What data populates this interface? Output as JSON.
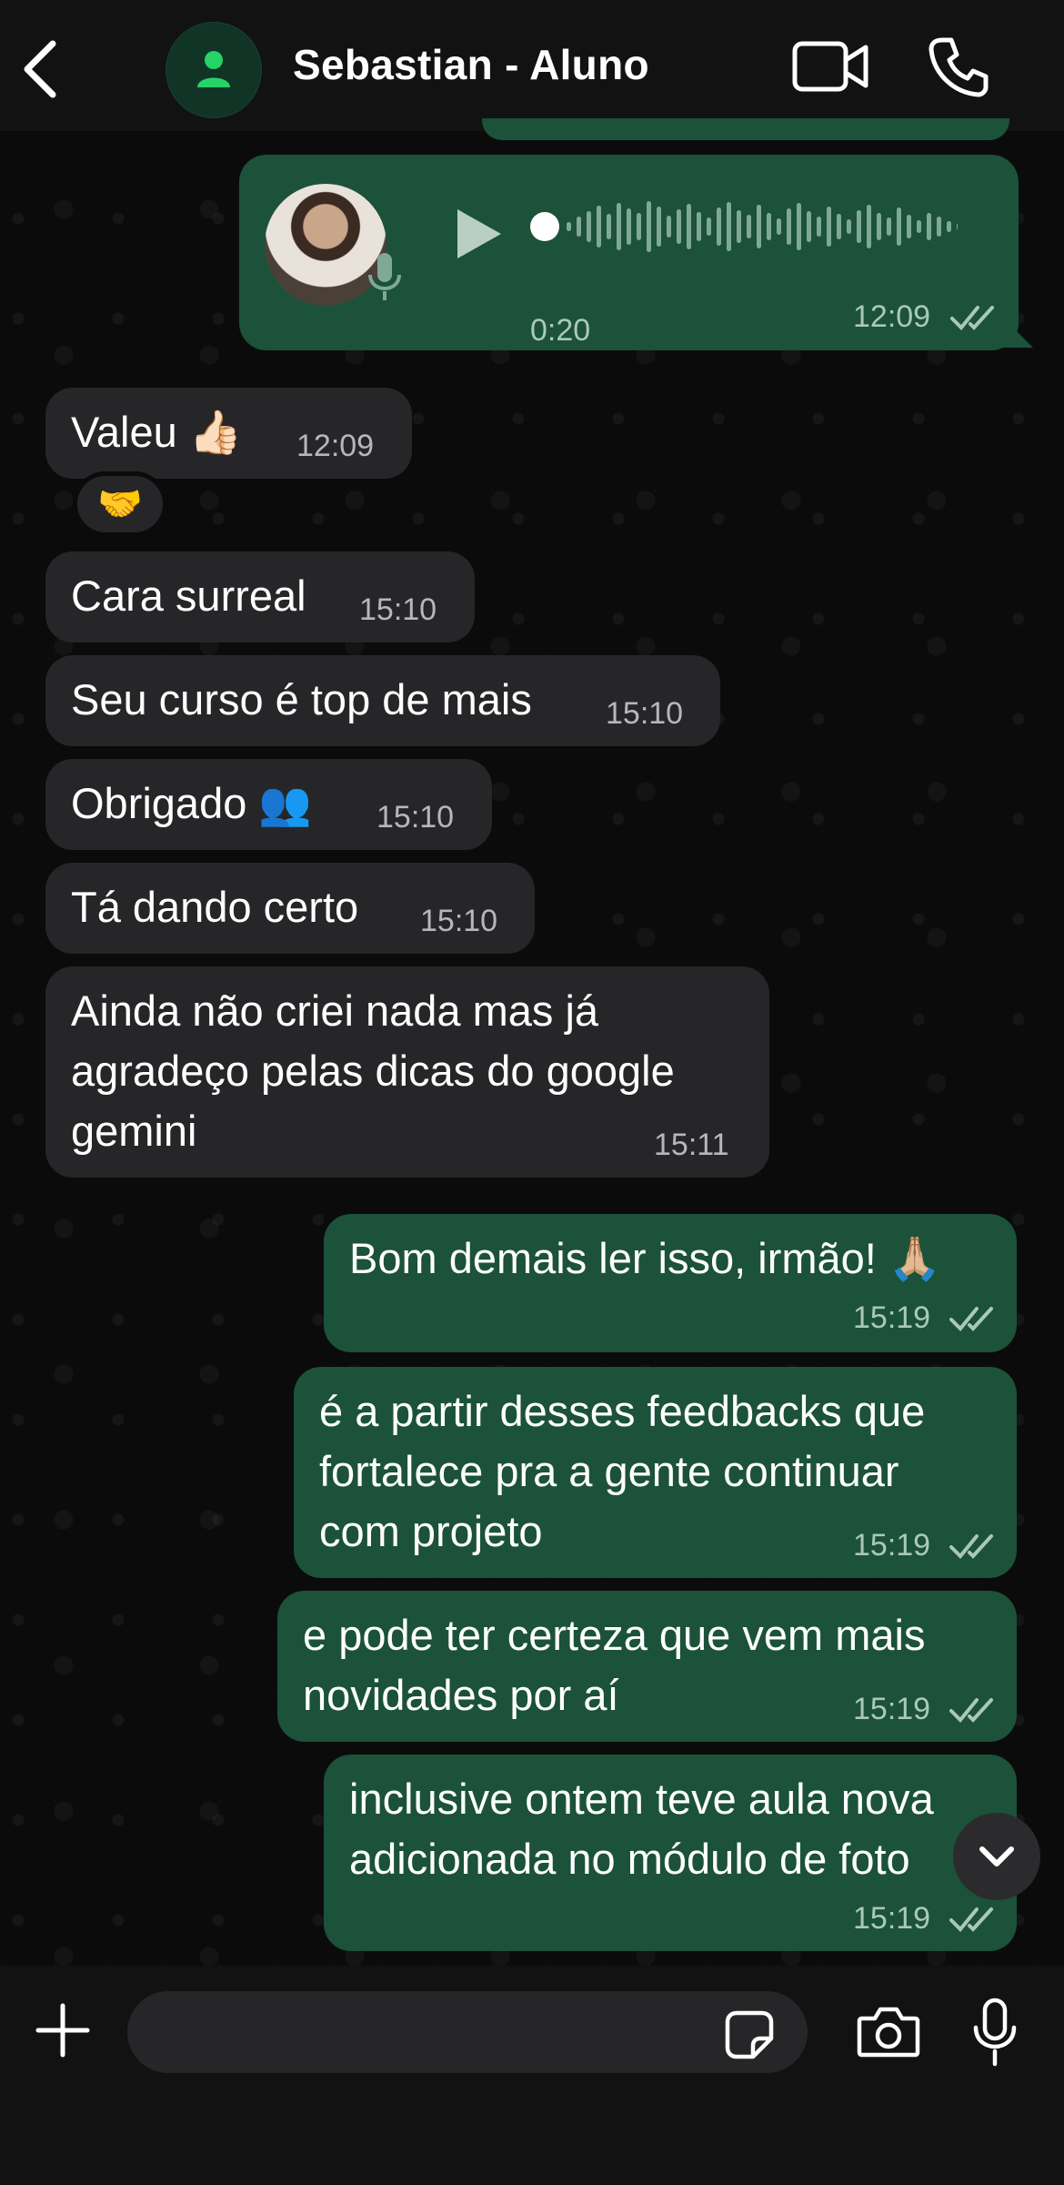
{
  "header": {
    "contact_name": "Sebastian - Aluno",
    "icons": {
      "back": "chevron-left-icon",
      "avatar": "person-icon",
      "video": "video-camera-icon",
      "call": "phone-icon"
    }
  },
  "voice_message": {
    "duration": "0:20",
    "time": "12:09",
    "status": "read"
  },
  "messages": [
    {
      "direction": "incoming",
      "text": "Valeu 👍🏻",
      "time": "12:09",
      "reaction": "🤝"
    },
    {
      "direction": "incoming",
      "text": "Cara surreal",
      "time": "15:10"
    },
    {
      "direction": "incoming",
      "text": "Seu curso é top de mais",
      "time": "15:10"
    },
    {
      "direction": "incoming",
      "text": "Obrigado 👥",
      "time": "15:10"
    },
    {
      "direction": "incoming",
      "text": "Tá dando certo",
      "time": "15:10"
    },
    {
      "direction": "incoming",
      "text": "Ainda não criei nada mas já\nagradeço pelas dicas do google\ngemini",
      "time": "15:11"
    },
    {
      "direction": "outgoing",
      "text": "Bom demais ler isso, irmão! 🙏🏼",
      "time": "15:19",
      "status": "read"
    },
    {
      "direction": "outgoing",
      "text": "é a partir desses feedbacks que\nfortalece pra a gente continuar\ncom projeto",
      "time": "15:19",
      "status": "read"
    },
    {
      "direction": "outgoing",
      "text": "e pode ter certeza que vem mais\nnovidades por aí",
      "time": "15:19",
      "status": "read"
    },
    {
      "direction": "outgoing",
      "text": "inclusive ontem teve aula nova\nadicionada no módulo de foto",
      "time": "15:19",
      "status": "read"
    }
  ],
  "composer": {
    "placeholder": "",
    "icons": [
      "plus-icon",
      "sticker-icon",
      "camera-icon",
      "microphone-icon"
    ]
  },
  "colors": {
    "background": "#0b0b0c",
    "bar": "#121212",
    "incoming_bubble": "#262628",
    "outgoing_bubble": "#1b5239",
    "read_ticks": "#a9c9b6"
  }
}
